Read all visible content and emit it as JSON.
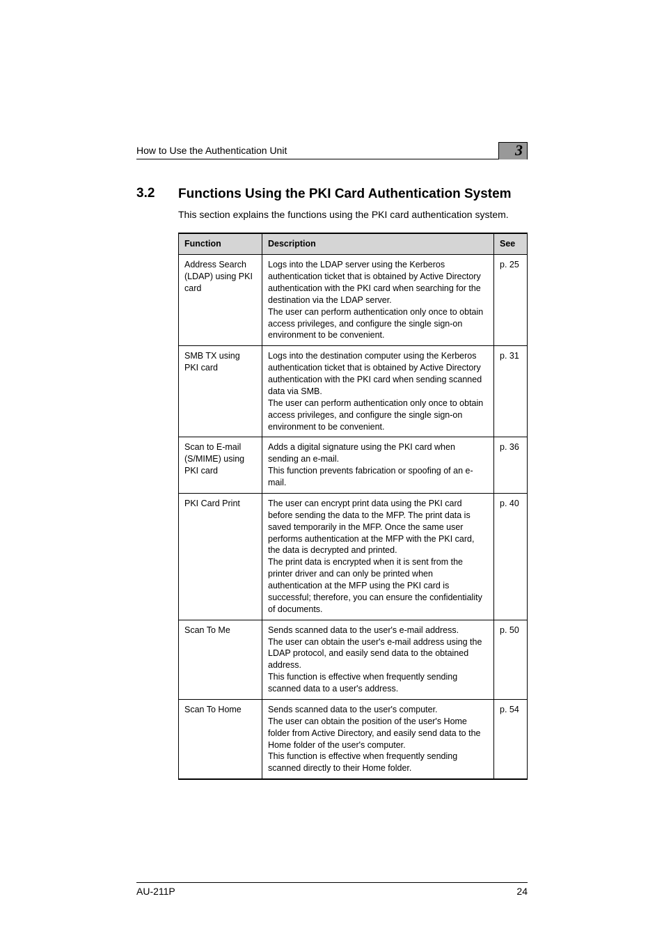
{
  "running_head": "How to Use the Authentication Unit",
  "chapter_number": "3",
  "section_number": "3.2",
  "section_title": "Functions Using the PKI Card Authentication System",
  "intro": "This section explains the functions using the PKI card authentication system.",
  "table": {
    "headers": {
      "function": "Function",
      "description": "Description",
      "see": "See"
    },
    "rows": [
      {
        "function": "Address Search (LDAP) using PKI card",
        "description_parts": [
          "Logs into the LDAP server using the Kerberos authentication ticket that is obtained by Active Directory authentication with the PKI card when searching for the destination via the LDAP server.",
          "The user can perform authentication only once to obtain access privileges, and configure the single sign-on environment to be convenient."
        ],
        "see": "p. 25"
      },
      {
        "function": "SMB TX using PKI card",
        "description_parts": [
          "Logs into the destination computer using the Kerberos authentication ticket that is obtained by Active Directory authentication with the PKI card when sending scanned data via SMB.",
          "The user can perform authentication only once to obtain access privileges, and configure the single sign-on environment to be convenient."
        ],
        "see": "p. 31"
      },
      {
        "function": "Scan to E-mail (S/MIME) using PKI card",
        "description_parts": [
          "Adds a digital signature using the PKI card when sending an e-mail.",
          "This function prevents fabrication or spoofing of an e-mail."
        ],
        "see": "p. 36"
      },
      {
        "function": "PKI Card Print",
        "description_parts": [
          "The user can encrypt print data using the PKI card before sending the data to the MFP. The print data is saved temporarily in the MFP. Once the same user performs authentication at the MFP with the PKI card, the data is decrypted and printed.",
          "The print data is encrypted when it is sent from the printer driver and can only be printed when authentication at the MFP using the PKI card is successful; therefore, you can ensure the confidentiality of documents."
        ],
        "see": "p. 40"
      },
      {
        "function": "Scan To Me",
        "description_parts": [
          "Sends scanned data to the user's e-mail address.",
          "The user can obtain the user's e-mail address using the LDAP protocol, and easily send data to the obtained address.",
          "This function is effective when frequently sending scanned data to a user's address."
        ],
        "see": "p. 50"
      },
      {
        "function": "Scan To Home",
        "description_parts": [
          "Sends scanned data to the user's computer.",
          "The user can obtain the position of the user's Home folder from Active Directory, and easily send data to the Home folder of the user's computer.",
          "This function is effective when frequently sending scanned directly to their Home folder."
        ],
        "see": "p. 54"
      }
    ]
  },
  "footer": {
    "model": "AU-211P",
    "page": "24"
  }
}
